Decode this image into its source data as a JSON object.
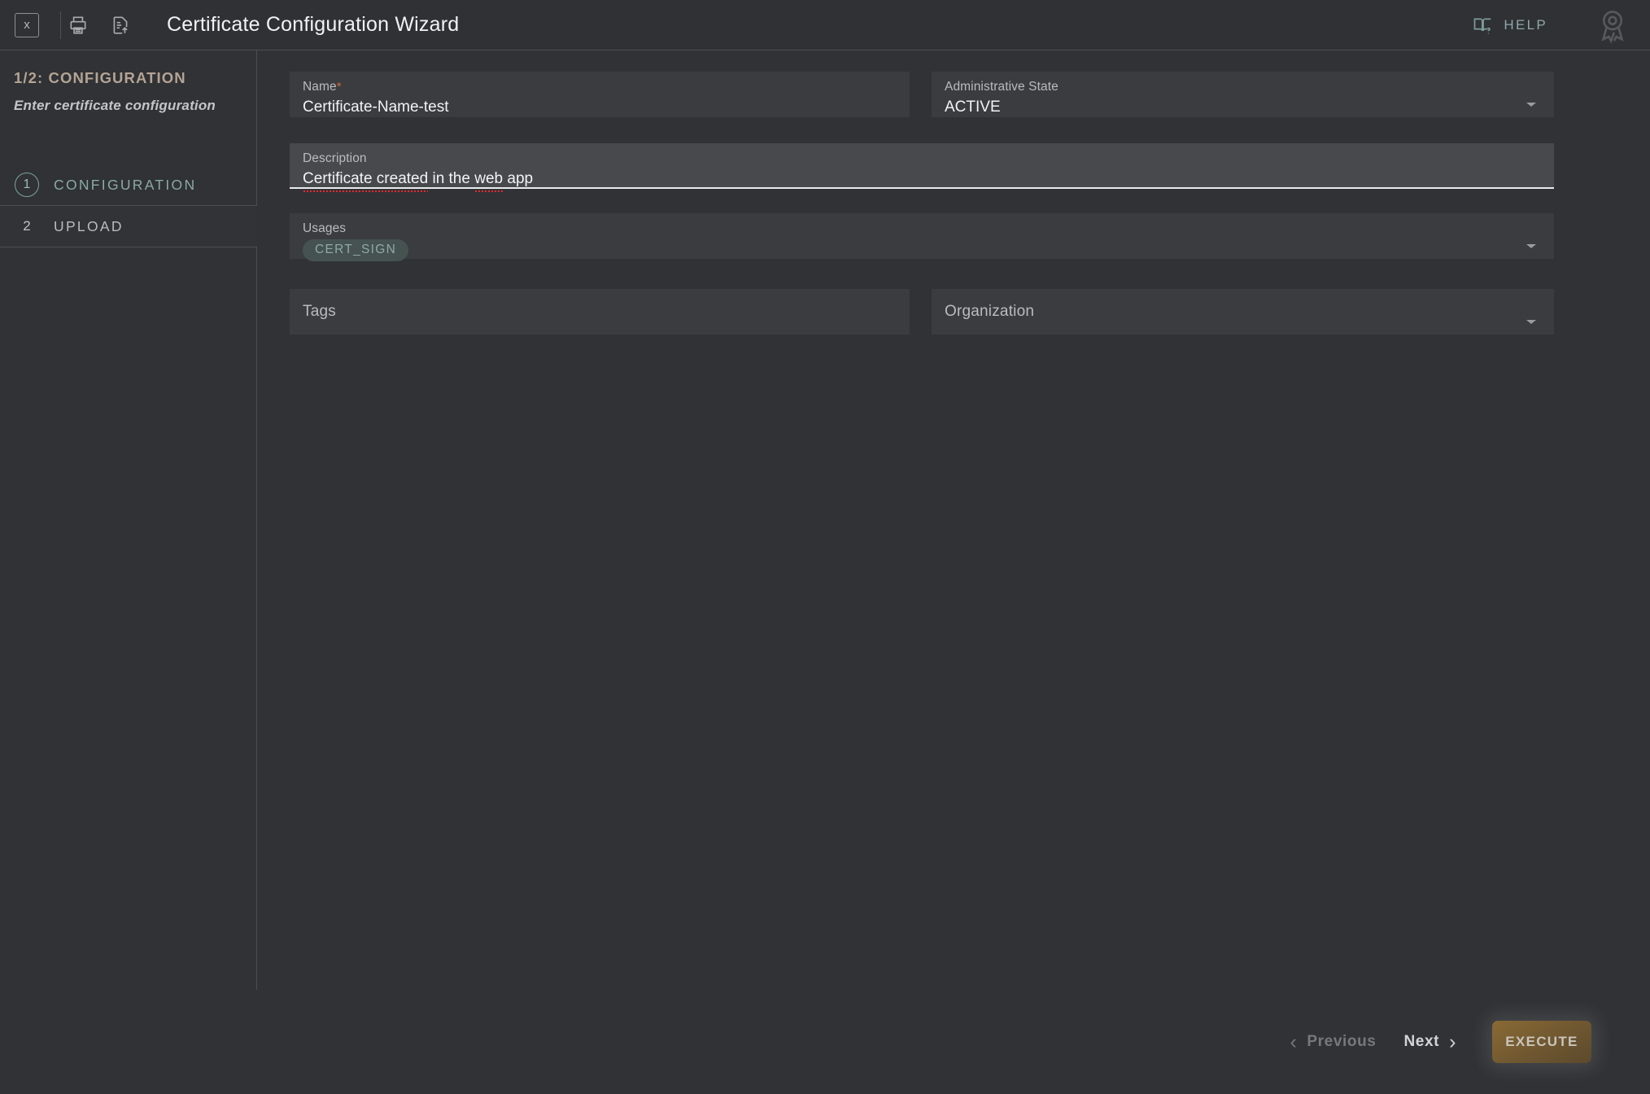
{
  "window": {
    "title": "Certificate Configuration Wizard"
  },
  "toolbar": {
    "close_label": "x",
    "close_icon": "close-boxed-icon",
    "print_icon": "printer-icon",
    "export_icon": "document-upload-icon",
    "help_label": "HELP",
    "help_icon": "book-question-icon",
    "user_icon": "certificate-ribbon-icon"
  },
  "sidebar": {
    "step_counter": "1/2: CONFIGURATION",
    "step_description": "Enter certificate configuration",
    "steps": [
      {
        "number": "1",
        "label": "CONFIGURATION",
        "state": "active"
      },
      {
        "number": "2",
        "label": "UPLOAD",
        "state": "pending"
      }
    ]
  },
  "form": {
    "name": {
      "label": "Name",
      "required_marker": "*",
      "value": "Certificate-Name-test"
    },
    "administrative_state": {
      "label": "Administrative State",
      "value": "ACTIVE"
    },
    "description": {
      "label": "Description",
      "value_part1": "Certificate created",
      "value_part2": " in the ",
      "value_part3": "web",
      "value_part4": " app",
      "value": "Certificate created in the web app"
    },
    "usages": {
      "label": "Usages",
      "chips": [
        "CERT_SIGN"
      ]
    },
    "tags": {
      "placeholder": "Tags"
    },
    "organization": {
      "placeholder": "Organization"
    }
  },
  "footer": {
    "previous_label": "Previous",
    "next_label": "Next",
    "execute_label": "EXECUTE"
  },
  "colors": {
    "accent_teal": "#8aa9a6",
    "accent_tan": "#b4a494",
    "required_red": "#d4663a",
    "execute_gold": "#7a6033",
    "background": "#303235",
    "field_background": "#3a3c3f",
    "field_focused": "#47494c"
  }
}
